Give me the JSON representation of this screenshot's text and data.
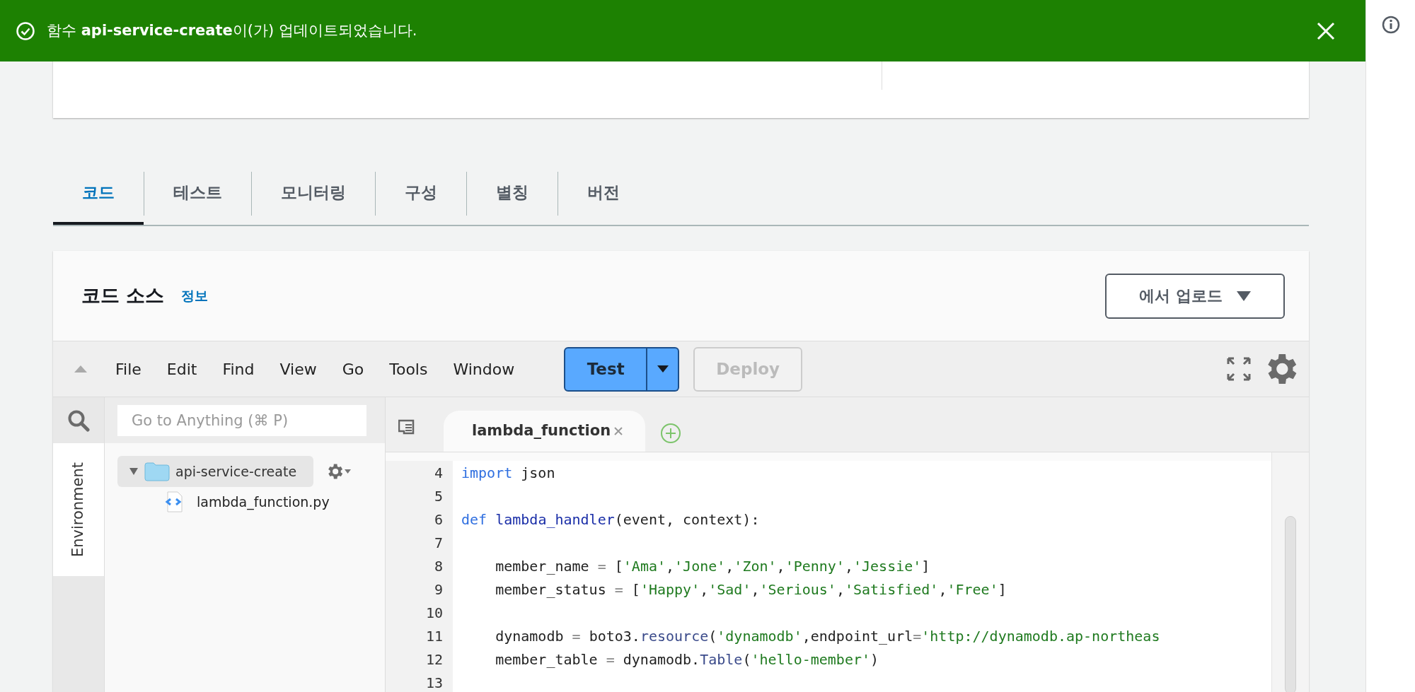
{
  "notification": {
    "message": "함수 **api-service-create**이(가) 업데이트되었습니다."
  },
  "tabs": [
    {
      "label": "코드",
      "selected": true
    },
    {
      "label": "테스트",
      "selected": false
    },
    {
      "label": "모니터링",
      "selected": false
    },
    {
      "label": "구성",
      "selected": false
    },
    {
      "label": "별칭",
      "selected": false
    },
    {
      "label": "버전",
      "selected": false
    }
  ],
  "code_source": {
    "title": "코드 소스",
    "info_link": "정보",
    "upload_button": "에서 업로드"
  },
  "ide": {
    "menu": [
      "File",
      "Edit",
      "Find",
      "View",
      "Go",
      "Tools",
      "Window"
    ],
    "test_button": "Test",
    "deploy_button": {
      "label": "Deploy",
      "disabled": true
    },
    "sidebar_tab": "Environment",
    "search": {
      "placeholder": "Go to Anything (⌘ P)"
    },
    "tree": [
      {
        "name": "api-service-create",
        "kind": "folder",
        "expanded": true,
        "children": [
          {
            "name": "lambda_function.py",
            "kind": "file"
          }
        ]
      }
    ],
    "editor_tab": "lambda_function",
    "lines": [
      {
        "number": "4",
        "tokens": [
          {
            "kind": "keyword",
            "text": "import"
          },
          {
            "kind": "plain",
            "text": " json"
          }
        ]
      },
      {
        "number": "5"
      },
      {
        "number": "6",
        "tokens": [
          {
            "kind": "keyword",
            "text": "def "
          },
          {
            "kind": "function",
            "text": "lambda_handler"
          },
          {
            "kind": "plain",
            "text": "(event, context):"
          }
        ]
      },
      {
        "number": "7"
      },
      {
        "number": "8",
        "tokens": [
          {
            "kind": "plain",
            "text": "    member_name "
          },
          {
            "kind": "operator",
            "text": "="
          },
          {
            "kind": "plain",
            "text": " ["
          },
          {
            "kind": "string",
            "text": "'Ama'"
          },
          {
            "kind": "plain",
            "text": ","
          },
          {
            "kind": "string",
            "text": "'Jone'"
          },
          {
            "kind": "plain",
            "text": ","
          },
          {
            "kind": "string",
            "text": "'Zon'"
          },
          {
            "kind": "plain",
            "text": ","
          },
          {
            "kind": "string",
            "text": "'Penny'"
          },
          {
            "kind": "plain",
            "text": ","
          },
          {
            "kind": "string",
            "text": "'Jessie'"
          },
          {
            "kind": "plain",
            "text": "]"
          }
        ]
      },
      {
        "number": "9",
        "tokens": [
          {
            "kind": "plain",
            "text": "    member_status "
          },
          {
            "kind": "operator",
            "text": "="
          },
          {
            "kind": "plain",
            "text": " ["
          },
          {
            "kind": "string",
            "text": "'Happy'"
          },
          {
            "kind": "plain",
            "text": ","
          },
          {
            "kind": "string",
            "text": "'Sad'"
          },
          {
            "kind": "plain",
            "text": ","
          },
          {
            "kind": "string",
            "text": "'Serious'"
          },
          {
            "kind": "plain",
            "text": ","
          },
          {
            "kind": "string",
            "text": "'Satisfied'"
          },
          {
            "kind": "plain",
            "text": ","
          },
          {
            "kind": "string",
            "text": "'Free'"
          },
          {
            "kind": "plain",
            "text": "]"
          }
        ]
      },
      {
        "number": "10"
      },
      {
        "number": "11",
        "tokens": [
          {
            "kind": "plain",
            "text": "    dynamodb "
          },
          {
            "kind": "operator",
            "text": "="
          },
          {
            "kind": "plain",
            "text": " boto3."
          },
          {
            "kind": "method",
            "text": "resource"
          },
          {
            "kind": "plain",
            "text": "("
          },
          {
            "kind": "string",
            "text": "'dynamodb'"
          },
          {
            "kind": "plain",
            "text": ",endpoint_url"
          },
          {
            "kind": "operator",
            "text": "="
          },
          {
            "kind": "string",
            "text": "'http://dynamodb.ap-northeas"
          }
        ]
      },
      {
        "number": "12",
        "tokens": [
          {
            "kind": "plain",
            "text": "    member_table "
          },
          {
            "kind": "operator",
            "text": "="
          },
          {
            "kind": "plain",
            "text": " dynamodb."
          },
          {
            "kind": "method",
            "text": "Table"
          },
          {
            "kind": "plain",
            "text": "("
          },
          {
            "kind": "string",
            "text": "'hello-member'"
          },
          {
            "kind": "plain",
            "text": ")"
          }
        ]
      },
      {
        "number": "13"
      }
    ]
  }
}
